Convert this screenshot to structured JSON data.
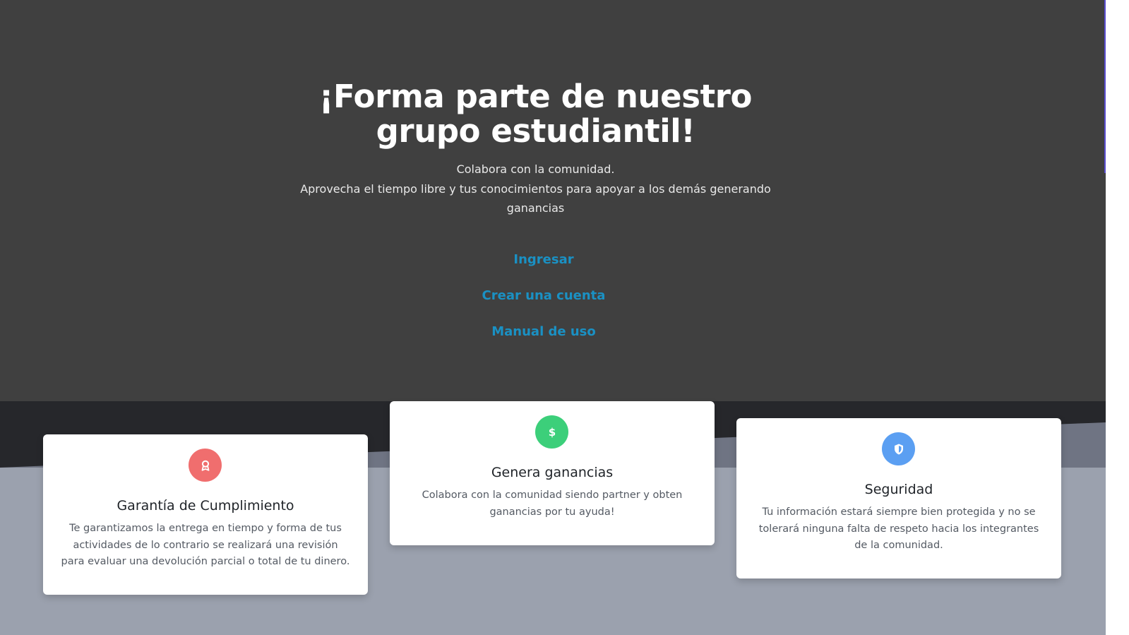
{
  "hero": {
    "title": "¡Forma parte de nuestro grupo estudiantil!",
    "subtitle_line1": "Colabora con la comunidad.",
    "subtitle_line2": "Aprovecha el tiempo libre y tus conocimientos para apoyar a los demás generando ganancias",
    "links": {
      "login": "Ingresar",
      "register": "Crear una cuenta",
      "manual": "Manual de uso"
    }
  },
  "features": [
    {
      "icon": "award-icon",
      "color": "#f06e6e",
      "title": "Garantía de Cumplimiento",
      "text": "Te garantizamos la entrega en tiempo y forma de tus actividades de lo contrario se realizará una revisión para evaluar una devolución parcial o total de tu dinero."
    },
    {
      "icon": "dollar-icon",
      "color": "#3ccf7a",
      "title": "Genera ganancias",
      "text": "Colabora con la comunidad siendo partner y obten ganancias por tu ayuda!"
    },
    {
      "icon": "shield-icon",
      "color": "#5b9ff2",
      "title": "Seguridad",
      "text": "Tu información estará siempre bien protegida y no se tolerará ninguna falta de respeto hacia los integrantes de la comunidad."
    }
  ],
  "colors": {
    "hero_background": "#404040",
    "link": "#1a91c4",
    "band_dark": "#26272b",
    "band_mid": "#6f7483",
    "band_light": "#9ba1ae"
  }
}
